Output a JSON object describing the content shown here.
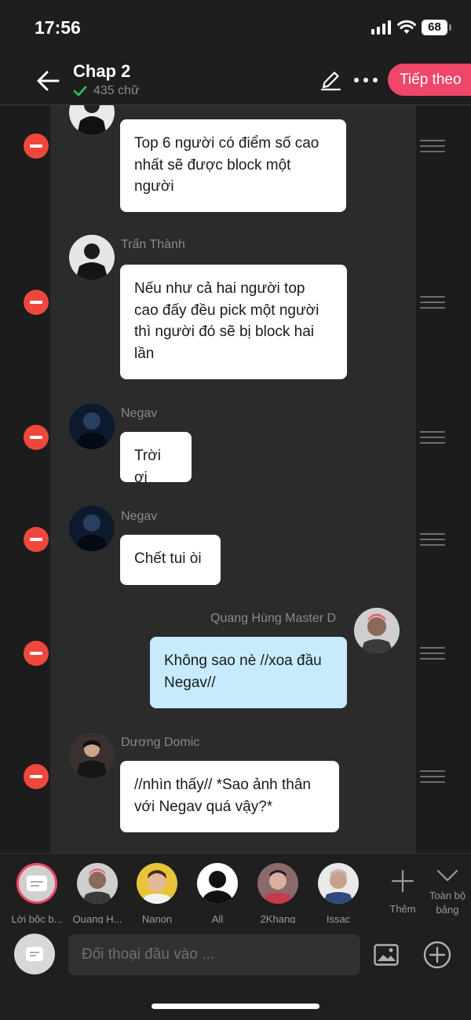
{
  "status_bar": {
    "time": "17:56",
    "battery": "68"
  },
  "header": {
    "title": "Chap 2",
    "word_count": "435 chữ",
    "next_label": "Tiếp theo"
  },
  "messages": [
    {
      "name": "",
      "text": "Top 6 người có điểm số cao nhất sẽ được block một người"
    },
    {
      "name": "Trấn Thành",
      "text": "Nếu như cả hai người top cao đấy đều pick một người thì người đó sẽ bị block hai lần"
    },
    {
      "name": "Negav",
      "text": "Trời ơi"
    },
    {
      "name": "Negav",
      "text": "Chết tui òi"
    },
    {
      "name": "Quang Hùng Master D",
      "text": "Không sao nè //xoa đầu Negav//"
    },
    {
      "name": "Dương Domic",
      "text": "//nhìn thấy// *Sao ảnh thân với Negav quá vậy?*"
    }
  ],
  "characters": [
    {
      "name": "Lời bộc b..."
    },
    {
      "name": "Quang H..."
    },
    {
      "name": "Nanon"
    },
    {
      "name": "All"
    },
    {
      "name": "2Khang"
    },
    {
      "name": "Issac"
    }
  ],
  "add_label": "Thêm",
  "all_board_label": "Toàn bộ bảng",
  "input": {
    "placeholder": "Đối thoại đầu vào ..."
  },
  "colors": {
    "accent": "#f0466a",
    "delete": "#f0473c",
    "bubble_self": "#c7ebfd",
    "bubble_other": "#ffffff"
  }
}
